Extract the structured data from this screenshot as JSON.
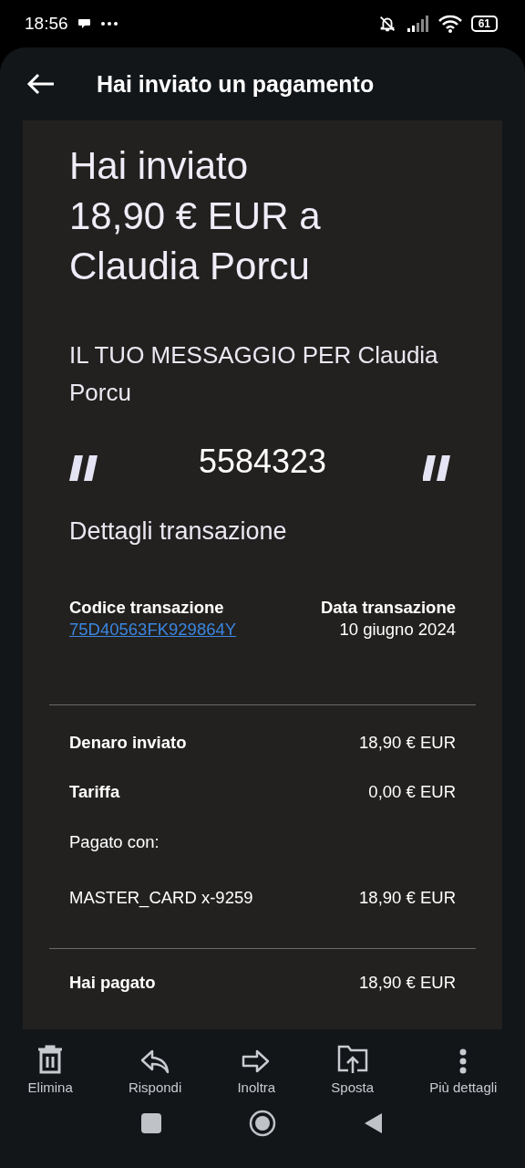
{
  "status_bar": {
    "time": "18:56",
    "battery": "61"
  },
  "header": {
    "title": "Hai inviato un pagamento"
  },
  "summary": {
    "lines": [
      "Hai inviato",
      "18,90 € EUR a",
      "Claudia Porcu"
    ]
  },
  "message": {
    "heading": "IL TUO MESSAGGIO PER Claudia Porcu",
    "text": "5584323"
  },
  "details": {
    "heading": "Dettagli transazione",
    "code_label": "Codice transazione",
    "code": "75D40563FK929864Y",
    "date_label": "Data transazione",
    "date": "10 giugno 2024"
  },
  "amounts": [
    {
      "kind": "bold",
      "label": "Denaro inviato",
      "value": "18,90 € EUR"
    },
    {
      "kind": "bold",
      "label": "Tariffa",
      "value": "0,00 € EUR"
    },
    {
      "kind": "note",
      "label": "Pagato con:"
    },
    {
      "kind": "plain",
      "label": "MASTER_CARD x-9259",
      "value": "18,90 € EUR"
    }
  ],
  "total": {
    "label": "Hai pagato",
    "value": "18,90 € EUR"
  },
  "toolbar": [
    {
      "kind": "trash",
      "label": "Elimina"
    },
    {
      "kind": "reply",
      "label": "Rispondi"
    },
    {
      "kind": "forward",
      "label": "Inoltra"
    },
    {
      "kind": "move",
      "label": "Sposta"
    },
    {
      "kind": "more",
      "label": "Più dettagli"
    }
  ]
}
